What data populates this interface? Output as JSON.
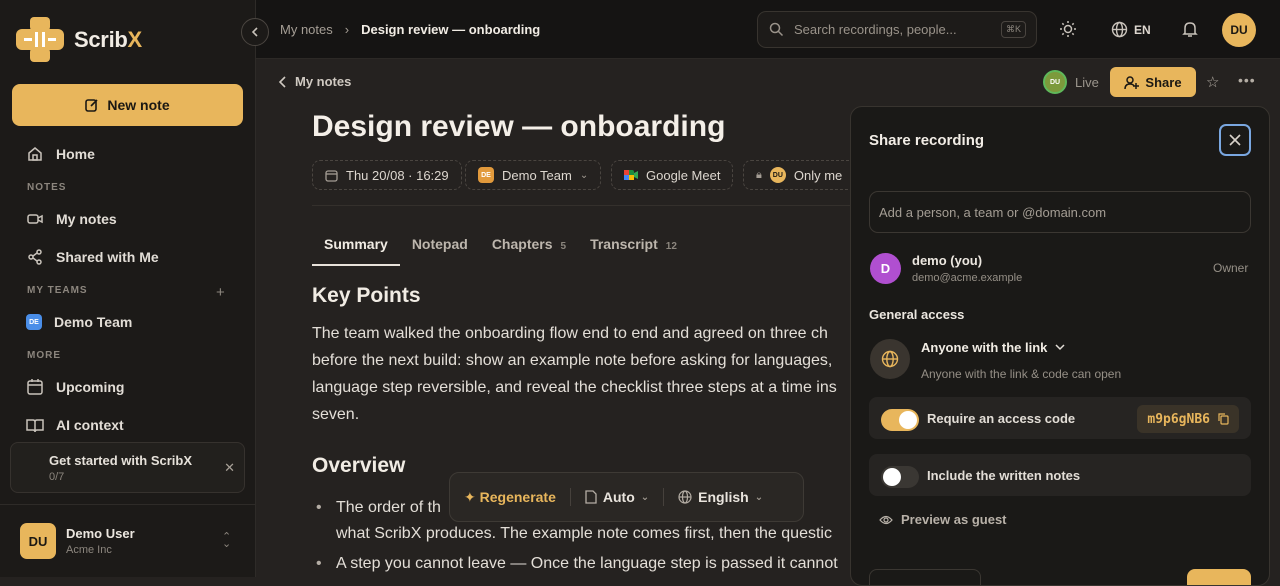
{
  "app": {
    "name_main": "Scrib",
    "name_accent": "X"
  },
  "sidebar": {
    "new_note": "New note",
    "home": "Home",
    "section_notes": "NOTES",
    "my_notes": "My notes",
    "shared": "Shared with Me",
    "section_teams": "MY TEAMS",
    "team_badge": "DE",
    "team": "Demo Team",
    "section_more": "MORE",
    "upcoming": "Upcoming",
    "ai_context": "AI context",
    "getstarted_title": "Get started with ScribX",
    "getstarted_count": "0/7",
    "user_initials": "DU",
    "user_name": "Demo User",
    "user_org": "Acme Inc"
  },
  "topbar": {
    "crumb_parent": "My notes",
    "crumb_current": "Design review — onboarding",
    "search_placeholder": "Search recordings, people...",
    "search_kbd": "⌘K",
    "lang": "EN",
    "avatar": "DU"
  },
  "note": {
    "back": "My notes",
    "live_avatar": "DU",
    "live": "Live",
    "share": "Share",
    "title": "Design review — onboarding",
    "chips": {
      "date": "Thu 20/08 · 16:29",
      "team_badge": "DE",
      "team": "Demo Team",
      "meet": "Google Meet",
      "access_avatar": "DU",
      "access": "Only me"
    },
    "tabs": [
      {
        "label": "Summary",
        "count": ""
      },
      {
        "label": "Notepad",
        "count": ""
      },
      {
        "label": "Chapters",
        "count": "5"
      },
      {
        "label": "Transcript",
        "count": "12"
      }
    ],
    "h_key_points": "Key Points",
    "para_lines": [
      "The team walked the onboarding flow end to end and agreed on three ch",
      "before the next build: show an example note before asking for languages,",
      "language step reversible, and reveal the checklist three steps at a time ins",
      "seven."
    ],
    "h_overview": "Overview",
    "bullets": [
      "The order of th                                              e anyo",
      "what ScribX produces. The example note comes first, then the questic",
      "A step you cannot leave — Once the language step is passed it cannot"
    ]
  },
  "floatbar": {
    "regenerate": "Regenerate",
    "mode": "Auto",
    "language": "English"
  },
  "share_panel": {
    "title": "Share recording",
    "input_placeholder": "Add a person, a team or @domain.com",
    "owner_initial": "D",
    "owner_name": "demo (you)",
    "owner_email": "demo@acme.example",
    "owner_role": "Owner",
    "general_access": "General access",
    "access_option": "Anyone with the link",
    "access_desc": "Anyone with the link & code can open",
    "require_code": "Require an access code",
    "require_code_on": true,
    "code": "m9p6gNB6",
    "include_notes": "Include the written notes",
    "include_notes_on": false,
    "preview": "Preview as guest"
  },
  "colors": {
    "accent": "#e8b65c",
    "bg": "#252220",
    "sidebar": "#1c1a18"
  }
}
